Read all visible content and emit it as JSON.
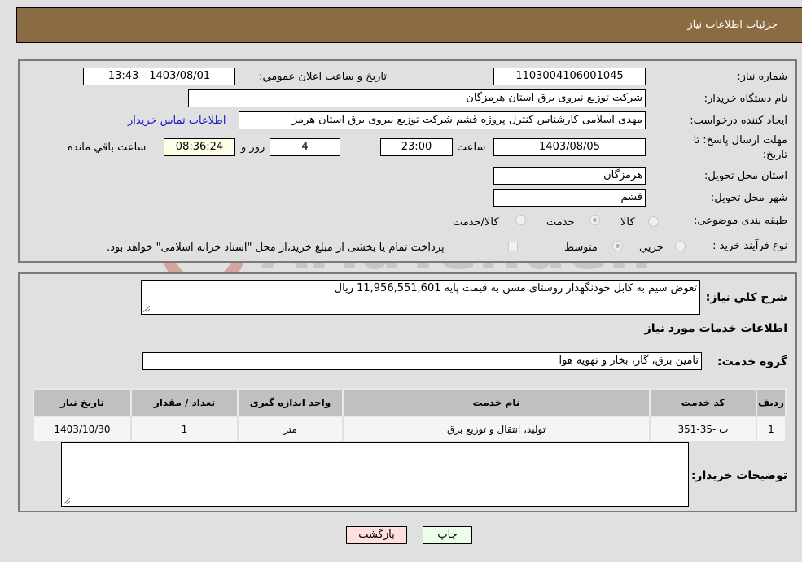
{
  "header": {
    "title": "جزئیات اطلاعات نیاز"
  },
  "fields": {
    "need_number_label": "شماره نیاز:",
    "need_number": "1103004106001045",
    "announce_label": "تاريخ و ساعت اعلان عمومي:",
    "announce_value": "1403/08/01 - 13:43",
    "buyer_org_label": "نام دستگاه خریدار:",
    "buyer_org": "شرکت توزیع نیروی برق استان هرمزگان",
    "creator_label": "ایجاد کننده درخواست:",
    "creator": "مهدی اسلامی کارشناس کنترل پروژه قشم شرکت توزیع نیروی برق استان هرمز",
    "buyer_contact_link": "اطلاعات تماس خریدار",
    "deadline_label_1": "مهلت ارسال پاسخ: تا",
    "deadline_label_2": "تاریخ:",
    "deadline_date": "1403/08/05",
    "time_label": "ساعت",
    "deadline_time": "23:00",
    "days_value": "4",
    "days_label": "روز و",
    "remaining_time": "08:36:24",
    "remaining_label": "ساعت باقي مانده",
    "province_label": "استان محل تحویل:",
    "province": "هرمزگان",
    "city_label": "شهر محل تحویل:",
    "city": "قشم",
    "category_label": "طبقه بندی موضوعی:",
    "category_options": [
      "کالا",
      "خدمت",
      "کالا/خدمت"
    ],
    "category_selected": "خدمت",
    "process_label": "نوع فرآیند خرید :",
    "process_options": [
      "جزيي",
      "متوسط"
    ],
    "process_selected": "متوسط",
    "treasury_note": "پرداخت تمام یا بخشی از مبلغ خرید،از محل \"اسناد خزانه اسلامی\" خواهد بود."
  },
  "details": {
    "summary_label": "شرح كلي نياز:",
    "summary": "تعوض سیم به کابل خودنگهدار روستای مسن به قیمت پایه 11,956,551,601 ریال",
    "services_heading": "اطلاعات خدمات مورد نیاز",
    "service_group_label": "گروه خدمت:",
    "service_group": "تامین برق، گاز، بخار و تهویه هوا",
    "table": {
      "headers": [
        "ردیف",
        "کد خدمت",
        "نام خدمت",
        "واحد اندازه گیری",
        "تعداد / مقدار",
        "تاریخ نیاز"
      ],
      "rows": [
        [
          "1",
          "ت -35-351",
          "تولید، انتقال و توزیع برق",
          "متر",
          "1",
          "1403/10/30"
        ]
      ]
    },
    "buyer_notes_label": "توضیحات خریدار:",
    "buyer_notes": ""
  },
  "buttons": {
    "print": "چاپ",
    "back": "بازگشت"
  },
  "watermark": {
    "text": "AriaTender.neT"
  }
}
